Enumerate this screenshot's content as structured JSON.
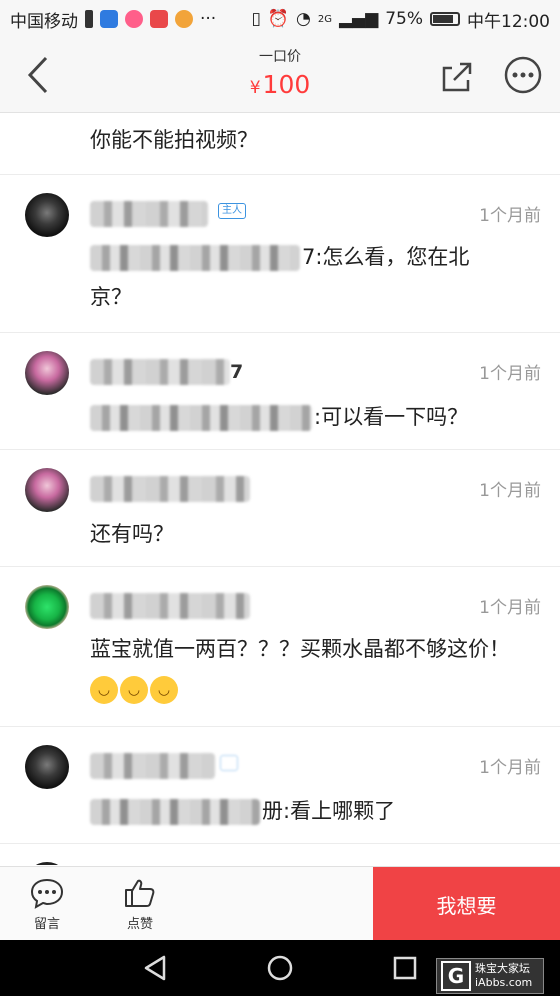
{
  "status_bar": {
    "carrier": "中国移动",
    "extra_dots": "···",
    "network": "2G",
    "battery": "75%",
    "time": "中午12:00"
  },
  "header": {
    "title": "一口价",
    "currency": "¥",
    "price": "100"
  },
  "comments": [
    {
      "avatar": "",
      "user": "",
      "time": "",
      "text": "你能不能拍视频？",
      "host_badge": ""
    },
    {
      "avatar": "dark",
      "user": "",
      "host_badge": "主人",
      "time": "1个月前",
      "text": "7:怎么看，您在北京？"
    },
    {
      "avatar": "pink",
      "user": "7",
      "host_badge": "",
      "time": "1个月前",
      "text": ":可以看一下吗？"
    },
    {
      "avatar": "pink",
      "user": "",
      "host_badge": "",
      "time": "1个月前",
      "text": "还有吗？"
    },
    {
      "avatar": "green",
      "user": "",
      "host_badge": "",
      "time": "1个月前",
      "text": "蓝宝就值一两百？？？买颗水晶都不够这价！"
    },
    {
      "avatar": "dark",
      "user": "",
      "host_badge": "",
      "time": "1个月前",
      "text": "册:看上哪颗了"
    }
  ],
  "actions": {
    "comment_label": "留言",
    "like_label": "点赞",
    "want_label": "我想要"
  },
  "watermark": {
    "letter": "G",
    "line1": "珠宝大家坛",
    "line2": "iAbbs.com"
  },
  "colors": {
    "price_red": "#ff3b3b",
    "want_button": "#f04345",
    "host_badge_blue": "#3c93e0"
  }
}
